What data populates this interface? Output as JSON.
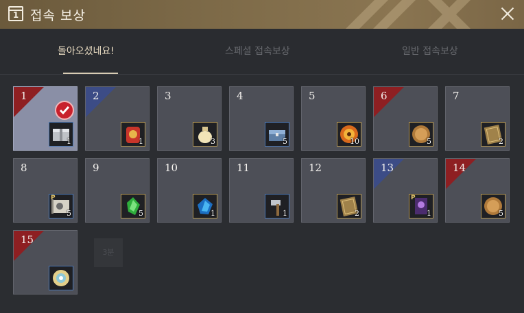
{
  "window": {
    "title": "접속 보상",
    "calendar_icon_digit": "1"
  },
  "icons": {
    "calendar": "calendar-icon",
    "close": "close-icon",
    "check": "check-icon"
  },
  "tabs": [
    {
      "label": "돌아오셨네요!",
      "active": true
    },
    {
      "label": "스페셜 접속보상",
      "active": false
    },
    {
      "label": "일반 접속보상",
      "active": false
    }
  ],
  "colors": {
    "title_bar": "#7d6a48",
    "red_corner": "#8e1f22",
    "blue_corner": "#3c4c86",
    "claimed_cell": "#8a8fa6",
    "gold_border": "#b79a55",
    "blue_border": "#4d7ab8"
  },
  "rewards": [
    {
      "day": "1",
      "qty": "1",
      "item": "silver-box-icon",
      "corner": "red",
      "claimed": true
    },
    {
      "day": "2",
      "qty": "1",
      "item": "red-bag-icon",
      "corner": "blue",
      "claimed": false
    },
    {
      "day": "3",
      "qty": "3",
      "item": "potion-jar-icon",
      "corner": "",
      "claimed": false
    },
    {
      "day": "4",
      "qty": "5",
      "item": "blue-chest-icon",
      "corner": "",
      "claimed": false
    },
    {
      "day": "5",
      "qty": "10",
      "item": "fire-orb-icon",
      "corner": "",
      "claimed": false
    },
    {
      "day": "6",
      "qty": "5",
      "item": "bronze-coin-icon",
      "corner": "red",
      "claimed": false
    },
    {
      "day": "7",
      "qty": "2",
      "item": "gold-card-icon",
      "corner": "",
      "claimed": false
    },
    {
      "day": "8",
      "qty": "5",
      "item": "map-scroll-icon",
      "corner": "",
      "claimed": false
    },
    {
      "day": "9",
      "qty": "5",
      "item": "green-crystal-icon",
      "corner": "",
      "claimed": false
    },
    {
      "day": "10",
      "qty": "1",
      "item": "blue-gem-icon",
      "corner": "",
      "claimed": false
    },
    {
      "day": "11",
      "qty": "1",
      "item": "hammer-icon",
      "corner": "",
      "claimed": false
    },
    {
      "day": "12",
      "qty": "2",
      "item": "gold-card-icon",
      "corner": "",
      "claimed": false
    },
    {
      "day": "13",
      "qty": "1",
      "item": "purple-banner-icon",
      "corner": "blue",
      "claimed": false
    },
    {
      "day": "14",
      "qty": "5",
      "item": "bronze-coin-icon",
      "corner": "red",
      "claimed": false
    },
    {
      "day": "15",
      "qty": "",
      "item": "gold-emblem-icon",
      "corner": "red",
      "claimed": false
    }
  ],
  "ghost_label": "3분"
}
